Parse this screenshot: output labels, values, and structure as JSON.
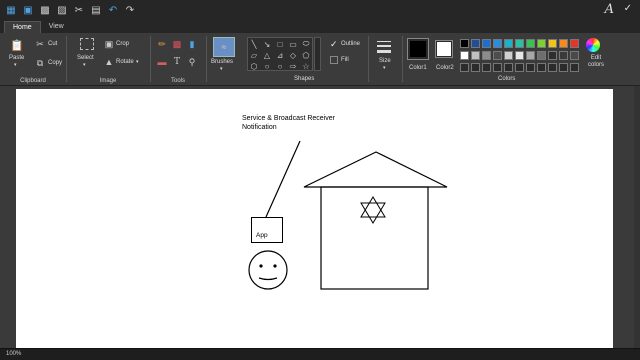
{
  "quick_access": {
    "icons": [
      "new-file-icon",
      "open-folder-icon",
      "save-icon",
      "print-icon",
      "cut-icon",
      "paste-icon",
      "undo-icon",
      "redo-icon"
    ],
    "font_glyph": "A",
    "check_glyph": "✓"
  },
  "tabs": [
    {
      "label": "Home",
      "active": true
    },
    {
      "label": "View",
      "active": false
    }
  ],
  "clipboard": {
    "paste_label": "Paste",
    "cut_label": "Cut",
    "copy_label": "Copy",
    "group_label": "Clipboard"
  },
  "image": {
    "select_label": "Select",
    "crop_label": "Crop",
    "rotate_label": "Rotate",
    "group_label": "Image"
  },
  "tools": {
    "text_tool": "A",
    "group_label": "Tools"
  },
  "brushes": {
    "label": "Brushes"
  },
  "shapes": {
    "outline_label": "Outline",
    "fill_label": "Fill",
    "group_label": "Shapes",
    "glyphs": [
      "╲",
      "↘",
      "□",
      "▭",
      "◯",
      "▱",
      "△",
      "⊿",
      "◇",
      "⬠",
      "⬡",
      "→",
      "⬠",
      "◯",
      "◯",
      "✦",
      "✧",
      "✩"
    ]
  },
  "size": {
    "label": "Size"
  },
  "colors": {
    "color1_label": "Color1",
    "color2_label": "Color2",
    "edit_label": "Edit colors",
    "group_label": "Colors",
    "color1": "#000000",
    "color2": "#ffffff",
    "row1": [
      "#000000",
      "#1f4e9c",
      "#1b6fd1",
      "#2a8de0",
      "#1ab1c9",
      "#22c4a5",
      "#37c453",
      "#7bd12f",
      "#f0c419",
      "#f58b1f",
      "#e5342b"
    ],
    "row2": [
      "#ffffff",
      "#c0c0c0",
      "#8c8c8c",
      "#4d4d4d",
      "#d0d0d0",
      "#e7e7e7",
      "#a8a8a8",
      "#6e6e6e",
      "#2e2e2e",
      "#3a3a3a",
      "#494949"
    ],
    "row3": [
      "#2b2b2b",
      "#2b2b2b",
      "#2b2b2b",
      "#2b2b2b",
      "#2b2b2b",
      "#2b2b2b",
      "#2b2b2b",
      "#2b2b2b",
      "#2b2b2b",
      "#2b2b2b",
      "#2b2b2b"
    ]
  },
  "canvas": {
    "note_text": "Service & Broadcast Receiver Notification",
    "app_label": "App"
  },
  "status": {
    "zoom": "100%"
  }
}
